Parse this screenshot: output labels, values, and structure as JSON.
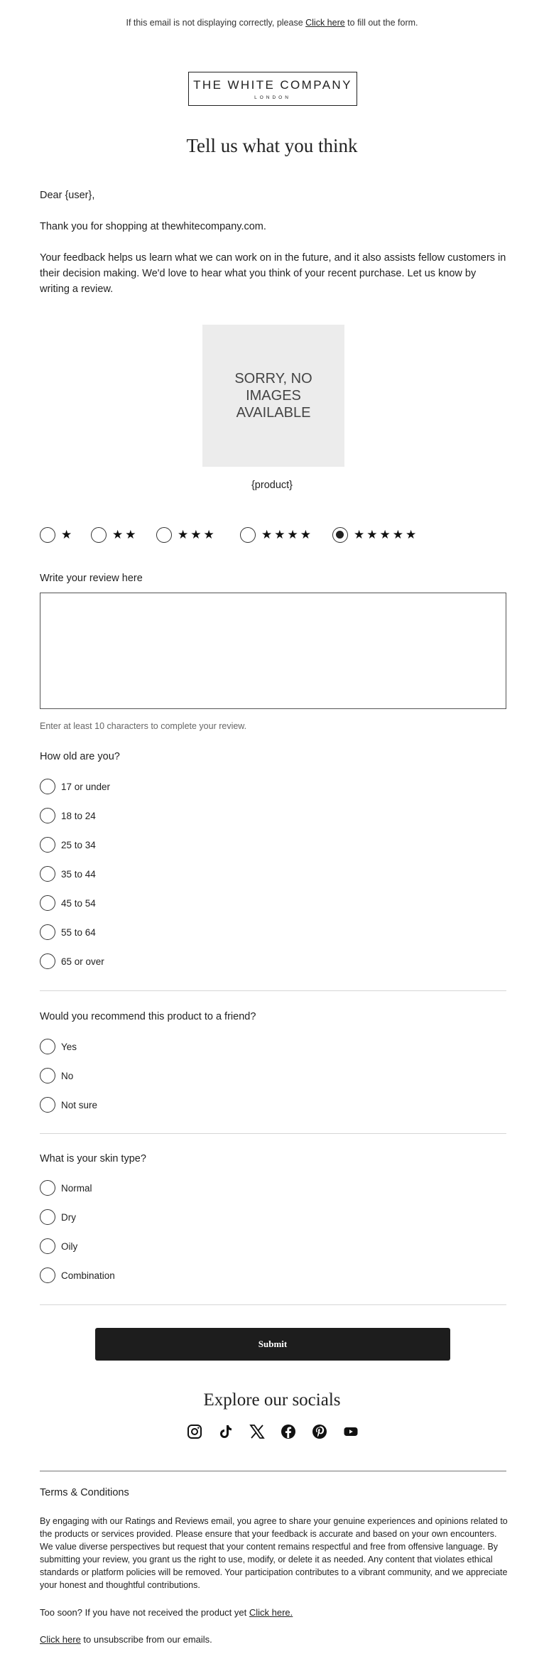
{
  "header": {
    "note_before": "If this email is not displaying correctly, please ",
    "note_link": "Click here",
    "note_after": " to fill out the form.",
    "logo_line1": "THE WHITE COMPANY",
    "logo_line2": "LONDON"
  },
  "intro": {
    "title": "Tell us what you think",
    "greeting": "Dear {user},",
    "thanks": "Thank you for shopping at thewhitecompany.com.",
    "body": "Your feedback helps us learn what we can work on in the future, and it also assists fellow customers in their decision making. We'd love to hear what you think of your recent purchase. Let us know by writing a review."
  },
  "product": {
    "no_image_text": "SORRY, NO\nIMAGES\nAVAILABLE",
    "name": "{product}"
  },
  "rating": {
    "selected": 5,
    "options": [
      {
        "stars": "★"
      },
      {
        "stars": "★★"
      },
      {
        "stars": "★★★"
      },
      {
        "stars": "★★★★"
      },
      {
        "stars": "★★★★★"
      }
    ]
  },
  "review": {
    "label": "Write your review here",
    "value": "",
    "hint": "Enter at least 10 characters to complete your review."
  },
  "age": {
    "question": "How old are you?",
    "options": [
      "17 or under",
      "18 to 24",
      "25 to 34",
      "35 to 44",
      "45 to 54",
      "55 to 64",
      "65 or over"
    ]
  },
  "recommend": {
    "question": "Would you recommend this product to a friend?",
    "options": [
      "Yes",
      "No",
      "Not sure"
    ]
  },
  "skin": {
    "question": "What is your skin type?",
    "options": [
      "Normal",
      "Dry",
      "Oily",
      "Combination"
    ]
  },
  "submit_label": "Submit",
  "socials": {
    "title": "Explore our socials",
    "icons": [
      "instagram-icon",
      "tiktok-icon",
      "x-icon",
      "facebook-icon",
      "pinterest-icon",
      "youtube-icon"
    ]
  },
  "terms": {
    "title": "Terms & Conditions",
    "body": "By engaging with our Ratings and Reviews email, you agree to share your genuine experiences and opinions related to the products or services provided. Please ensure that your feedback is accurate and based on your own encounters. We value diverse perspectives but request that your content remains respectful and free from offensive language. By submitting your review, you grant us the right to use, modify, or delete it as needed. Any content that violates ethical standards or platform policies will be removed. Your participation contributes to a vibrant community, and we appreciate your honest and thoughtful contributions."
  },
  "footer": {
    "too_soon_text": "Too soon? If you have not received the product yet ",
    "too_soon_link": "Click here.",
    "unsub_link": "Click here",
    "unsub_text": " to unsubscribe from our emails."
  }
}
